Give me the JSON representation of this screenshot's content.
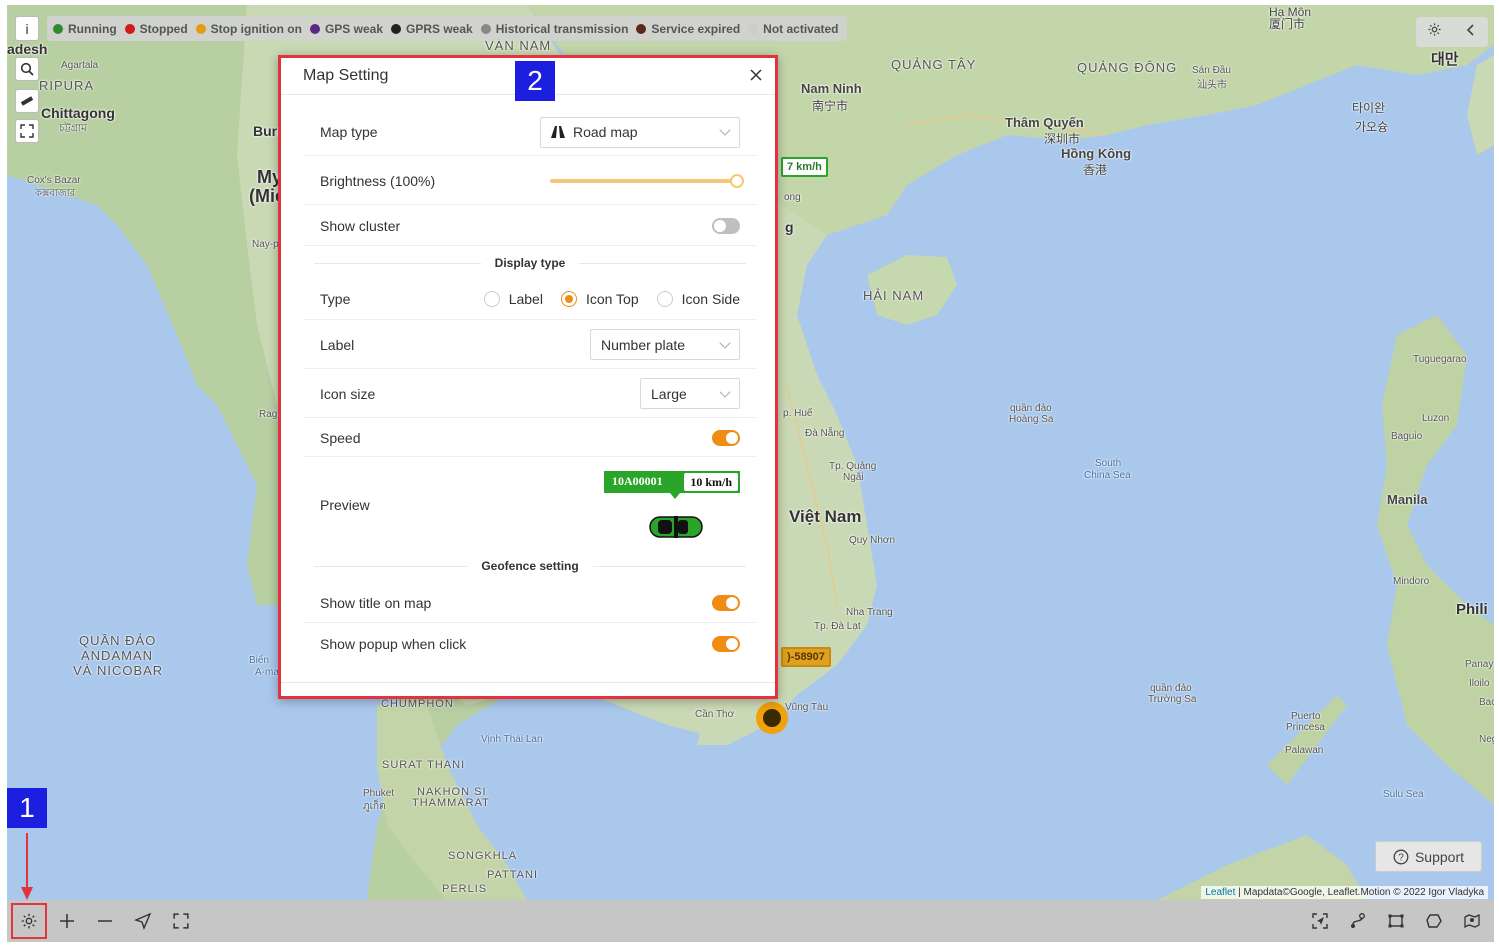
{
  "legend": [
    {
      "label": "Running",
      "color": "#2e8b2e"
    },
    {
      "label": "Stopped",
      "color": "#d11a1a"
    },
    {
      "label": "Stop ignition on",
      "color": "#e89a10"
    },
    {
      "label": "GPS weak",
      "color": "#5a2a82"
    },
    {
      "label": "GPRS weak",
      "color": "#222222"
    },
    {
      "label": "Historical transmission",
      "color": "#888888"
    },
    {
      "label": "Service expired",
      "color": "#5b2a1a"
    },
    {
      "label": "Not activated",
      "color": "#cccccc"
    }
  ],
  "map_controls": {
    "info": "i",
    "search_icon": "search-icon",
    "ruler_icon": "ruler-icon",
    "fullscreen_icon": "expand-icon"
  },
  "map_labels": {
    "bangladesh": "adesh",
    "agartala": "Agartala",
    "tripura": "RIPURA",
    "chittagong": "Chittagong",
    "chittagong_bn": "চট্টগ্রাম",
    "coxs": "Cox's Bazar",
    "coxs_bn": "কক্সবাজার",
    "burr": "Burr",
    "myanmar": "My",
    "mie": "(Mie",
    "nay": "Nay-p",
    "rag": "Rag",
    "andaman": "QUẦN ĐẢO",
    "andaman2": "ANDAMAN",
    "andaman3": "VÀ NICOBAR",
    "bien": "Biển",
    "anam": "A-ma",
    "chumphon": "CHUMPHON",
    "surat": "SURAT THANI",
    "phuket": "Phuket",
    "phuket_th": "ภูเก็ต",
    "nakhon": "NAKHON SI",
    "nakhon2": "THAMMARAT",
    "songkhla": "SONGKHLA",
    "pattani": "PATTANI",
    "perlis": "PERLIS",
    "vinh_thai_lan": "Vịnh Thái Lan",
    "van_nam": "VÂN NAM",
    "quang_tay": "QUẢNG TÂY",
    "quang_dong": "QUẢNG ĐÔNG",
    "nam_ninh": "Nam Ninh",
    "nam_ninh_cn": "南宁市",
    "tham_quyen": "Thâm Quyến",
    "tham_quyen_cn": "深圳市",
    "hong_kong": "Hồng Kông",
    "hong_kong_cn": "香港",
    "san_dau": "Sán Đầu",
    "san_dau_cn": "汕头市",
    "ha_mon": "Hạ Môn",
    "ha_mon_cn": "厦门市",
    "taiwan": "타이완",
    "taiwan2": "가오슝",
    "hai_nam": "HẢI NAM",
    "hoang_sa": "quần đảo",
    "hoang_sa2": "Hoàng Sa",
    "south_china_sea": "South",
    "south_china_sea2": "China Sea",
    "truong_sa": "quần đảo",
    "truong_sa2": "Trường Sa",
    "hue": "p. Huế",
    "da_nang": "Đà Nẵng",
    "quang_ngai": "Tp. Quảng",
    "quang_ngai2": "Ngãi",
    "viet_nam": "Việt Nam",
    "quy_nhon": "Quy Nhơn",
    "nha_trang": "Nha Trang",
    "da_lat": "Tp. Đà Lạt",
    "can_tho": "Cần Thơ",
    "vung_tau": "Vũng Tàu",
    "tuguegarao": "Tuguegarao",
    "luzon": "Luzon",
    "baguio": "Baguio",
    "manila": "Manila",
    "mindoro": "Mindoro",
    "phil": "Phili",
    "puerto": "Puerto",
    "princesa": "Princesa",
    "palawan": "Palawan",
    "sulu": "Sulu Sea",
    "iloilo": "Iloilo",
    "panay": "Panay",
    "bac": "Bac",
    "neg": "Neg",
    "daehan": "대만",
    "ong": "ong",
    "g": "g"
  },
  "map_badges": {
    "speed_partial": "7 km/h",
    "plate_partial": ")-58907"
  },
  "top_right": {
    "gear_icon": "gear-icon",
    "collapse_icon": "chevron-left-icon"
  },
  "bottom_bar": {
    "left": [
      "gear-icon",
      "plus-icon",
      "minus-icon",
      "locate-icon",
      "expand-icon"
    ],
    "right": [
      "focus-icon",
      "route-icon",
      "select-area-icon",
      "polygon-icon",
      "geofence-icon"
    ]
  },
  "attribution": {
    "leaflet": "Leaflet",
    "rest": " | Mapdata©Google, Leaflet.Motion © 2022 Igor Vladyka"
  },
  "support": {
    "label": "Support"
  },
  "annotations": {
    "one": "1",
    "two": "2"
  },
  "dialog": {
    "title": "Map Setting",
    "map_type": {
      "label": "Map type",
      "value": "Road map"
    },
    "brightness": {
      "label": "Brightness (100%)",
      "value_percent": 100
    },
    "cluster": {
      "label": "Show cluster",
      "on": false
    },
    "display_type_heading": "Display type",
    "type": {
      "label": "Type",
      "options": [
        "Label",
        "Icon Top",
        "Icon Side"
      ],
      "selected": "Icon Top"
    },
    "label": {
      "label": "Label",
      "value": "Number plate"
    },
    "icon_size": {
      "label": "Icon size",
      "value": "Large"
    },
    "speed": {
      "label": "Speed",
      "on": true
    },
    "preview": {
      "label": "Preview",
      "plate": "10A00001",
      "speed": "10 km/h"
    },
    "geofence_heading": "Geofence setting",
    "show_title": {
      "label": "Show title on map",
      "on": true
    },
    "show_popup": {
      "label": "Show popup when click",
      "on": true
    }
  },
  "colors": {
    "accent": "#f08c14",
    "running_green": "#2aa52a",
    "highlight_red": "#e2333f",
    "annotation_blue": "#1d1fe0"
  }
}
